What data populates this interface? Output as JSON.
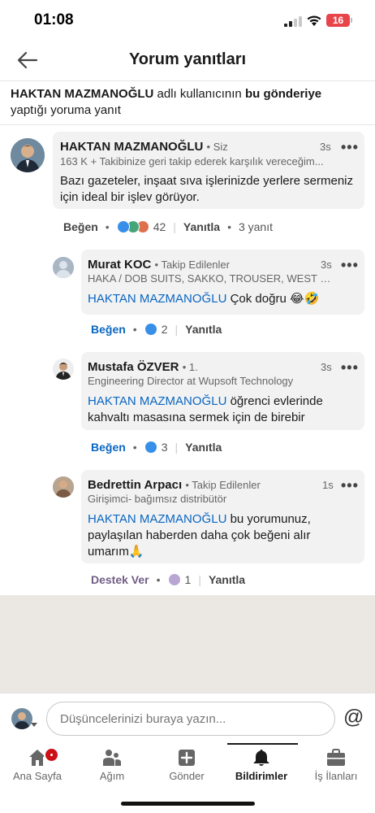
{
  "status_bar": {
    "time": "01:08",
    "battery": "16"
  },
  "header": {
    "title": "Yorum yanıtları"
  },
  "context": {
    "user": "HAKTAN MAZMANOĞLU",
    "mid": " adlı kullanıcının ",
    "post": "bu gönderiye",
    "end": " yaptığı yoruma yanıt"
  },
  "main_comment": {
    "name": "HAKTAN MAZMANOĞLU",
    "relation": "• Siz",
    "subtitle": "163 K + Takibinize geri takip ederek karşılık vereceğim...",
    "time": "3s",
    "text": "Bazı gazeteler, inşaat sıva işlerinizde yerlere sermeniz için ideal bir işlev görüyor.",
    "like_label": "Beğen",
    "reaction_count": "42",
    "reply_label": "Yanıtla",
    "replies_count": "3 yanıt"
  },
  "replies": [
    {
      "name": "Murat KOC",
      "relation": "• Takip Edilenler",
      "subtitle": "HAKA / DOB SUITS, SAKKO, TROUSER, WEST /...",
      "time": "3s",
      "mention": "HAKTAN MAZMANOĞLU",
      "text": " Çok doğru 😂🤣",
      "like_label": "Beğen",
      "reaction_count": "2",
      "reply_label": "Yanıtla"
    },
    {
      "name": "Mustafa ÖZVER",
      "relation": "• 1.",
      "subtitle": "Engineering Director at Wupsoft Technology",
      "time": "3s",
      "mention": "HAKTAN MAZMANOĞLU",
      "text": " öğrenci evlerinde kahvaltı masasına sermek için de birebir",
      "like_label": "Beğen",
      "reaction_count": "3",
      "reply_label": "Yanıtla"
    },
    {
      "name": "Bedrettin Arpacı",
      "relation": "• Takip Edilenler",
      "subtitle": "Girişimci- bağımsız distribütör",
      "time": "1s",
      "mention": "HAKTAN MAZMANOĞLU",
      "text": " bu yorumunuz, paylaşılan haberden daha çok beğeni alır umarım🙏",
      "like_label": "Destek Ver",
      "reaction_count": "1",
      "reply_label": "Yanıtla"
    }
  ],
  "composer": {
    "placeholder": "Düşüncelerinizi buraya yazın...",
    "at_symbol": "@"
  },
  "tabbar": {
    "items": [
      {
        "label": "Ana Sayfa",
        "icon": "home-icon"
      },
      {
        "label": "Ağım",
        "icon": "network-icon"
      },
      {
        "label": "Gönder",
        "icon": "post-icon"
      },
      {
        "label": "Bildirimler",
        "icon": "bell-icon"
      },
      {
        "label": "İş İlanları",
        "icon": "briefcase-icon"
      }
    ]
  },
  "colors": {
    "accent": "#0a66c2",
    "support": "#715e86",
    "badge": "#cc1016"
  }
}
